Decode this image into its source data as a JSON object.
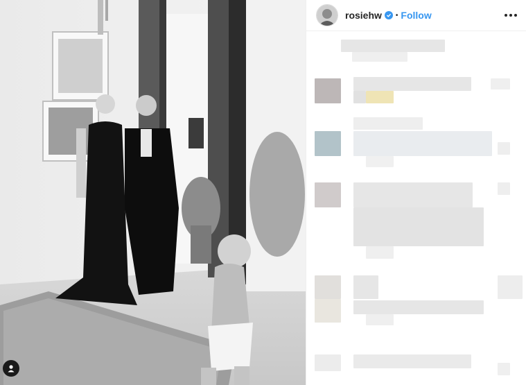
{
  "header": {
    "username": "rosiehw",
    "separator": "•",
    "follow_label": "Follow",
    "verified": true
  },
  "icons": {
    "avatar": "avatar",
    "verified": "verified-badge-icon",
    "more": "more-options-icon",
    "user_tag": "user-tag-icon"
  },
  "colors": {
    "accent": "#3897f0",
    "text": "#262626",
    "border": "#efefef",
    "blur_placeholder": "#e6e6e6"
  },
  "comments": {
    "count_visible_blurred": 6
  }
}
